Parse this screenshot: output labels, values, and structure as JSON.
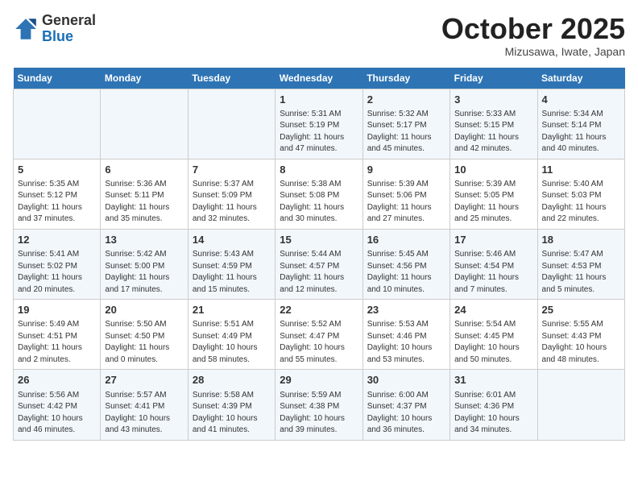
{
  "header": {
    "logo_line1": "General",
    "logo_line2": "Blue",
    "month": "October 2025",
    "location": "Mizusawa, Iwate, Japan"
  },
  "weekdays": [
    "Sunday",
    "Monday",
    "Tuesday",
    "Wednesday",
    "Thursday",
    "Friday",
    "Saturday"
  ],
  "weeks": [
    [
      {
        "day": "",
        "content": ""
      },
      {
        "day": "",
        "content": ""
      },
      {
        "day": "",
        "content": ""
      },
      {
        "day": "1",
        "content": "Sunrise: 5:31 AM\nSunset: 5:19 PM\nDaylight: 11 hours\nand 47 minutes."
      },
      {
        "day": "2",
        "content": "Sunrise: 5:32 AM\nSunset: 5:17 PM\nDaylight: 11 hours\nand 45 minutes."
      },
      {
        "day": "3",
        "content": "Sunrise: 5:33 AM\nSunset: 5:15 PM\nDaylight: 11 hours\nand 42 minutes."
      },
      {
        "day": "4",
        "content": "Sunrise: 5:34 AM\nSunset: 5:14 PM\nDaylight: 11 hours\nand 40 minutes."
      }
    ],
    [
      {
        "day": "5",
        "content": "Sunrise: 5:35 AM\nSunset: 5:12 PM\nDaylight: 11 hours\nand 37 minutes."
      },
      {
        "day": "6",
        "content": "Sunrise: 5:36 AM\nSunset: 5:11 PM\nDaylight: 11 hours\nand 35 minutes."
      },
      {
        "day": "7",
        "content": "Sunrise: 5:37 AM\nSunset: 5:09 PM\nDaylight: 11 hours\nand 32 minutes."
      },
      {
        "day": "8",
        "content": "Sunrise: 5:38 AM\nSunset: 5:08 PM\nDaylight: 11 hours\nand 30 minutes."
      },
      {
        "day": "9",
        "content": "Sunrise: 5:39 AM\nSunset: 5:06 PM\nDaylight: 11 hours\nand 27 minutes."
      },
      {
        "day": "10",
        "content": "Sunrise: 5:39 AM\nSunset: 5:05 PM\nDaylight: 11 hours\nand 25 minutes."
      },
      {
        "day": "11",
        "content": "Sunrise: 5:40 AM\nSunset: 5:03 PM\nDaylight: 11 hours\nand 22 minutes."
      }
    ],
    [
      {
        "day": "12",
        "content": "Sunrise: 5:41 AM\nSunset: 5:02 PM\nDaylight: 11 hours\nand 20 minutes."
      },
      {
        "day": "13",
        "content": "Sunrise: 5:42 AM\nSunset: 5:00 PM\nDaylight: 11 hours\nand 17 minutes."
      },
      {
        "day": "14",
        "content": "Sunrise: 5:43 AM\nSunset: 4:59 PM\nDaylight: 11 hours\nand 15 minutes."
      },
      {
        "day": "15",
        "content": "Sunrise: 5:44 AM\nSunset: 4:57 PM\nDaylight: 11 hours\nand 12 minutes."
      },
      {
        "day": "16",
        "content": "Sunrise: 5:45 AM\nSunset: 4:56 PM\nDaylight: 11 hours\nand 10 minutes."
      },
      {
        "day": "17",
        "content": "Sunrise: 5:46 AM\nSunset: 4:54 PM\nDaylight: 11 hours\nand 7 minutes."
      },
      {
        "day": "18",
        "content": "Sunrise: 5:47 AM\nSunset: 4:53 PM\nDaylight: 11 hours\nand 5 minutes."
      }
    ],
    [
      {
        "day": "19",
        "content": "Sunrise: 5:49 AM\nSunset: 4:51 PM\nDaylight: 11 hours\nand 2 minutes."
      },
      {
        "day": "20",
        "content": "Sunrise: 5:50 AM\nSunset: 4:50 PM\nDaylight: 11 hours\nand 0 minutes."
      },
      {
        "day": "21",
        "content": "Sunrise: 5:51 AM\nSunset: 4:49 PM\nDaylight: 10 hours\nand 58 minutes."
      },
      {
        "day": "22",
        "content": "Sunrise: 5:52 AM\nSunset: 4:47 PM\nDaylight: 10 hours\nand 55 minutes."
      },
      {
        "day": "23",
        "content": "Sunrise: 5:53 AM\nSunset: 4:46 PM\nDaylight: 10 hours\nand 53 minutes."
      },
      {
        "day": "24",
        "content": "Sunrise: 5:54 AM\nSunset: 4:45 PM\nDaylight: 10 hours\nand 50 minutes."
      },
      {
        "day": "25",
        "content": "Sunrise: 5:55 AM\nSunset: 4:43 PM\nDaylight: 10 hours\nand 48 minutes."
      }
    ],
    [
      {
        "day": "26",
        "content": "Sunrise: 5:56 AM\nSunset: 4:42 PM\nDaylight: 10 hours\nand 46 minutes."
      },
      {
        "day": "27",
        "content": "Sunrise: 5:57 AM\nSunset: 4:41 PM\nDaylight: 10 hours\nand 43 minutes."
      },
      {
        "day": "28",
        "content": "Sunrise: 5:58 AM\nSunset: 4:39 PM\nDaylight: 10 hours\nand 41 minutes."
      },
      {
        "day": "29",
        "content": "Sunrise: 5:59 AM\nSunset: 4:38 PM\nDaylight: 10 hours\nand 39 minutes."
      },
      {
        "day": "30",
        "content": "Sunrise: 6:00 AM\nSunset: 4:37 PM\nDaylight: 10 hours\nand 36 minutes."
      },
      {
        "day": "31",
        "content": "Sunrise: 6:01 AM\nSunset: 4:36 PM\nDaylight: 10 hours\nand 34 minutes."
      },
      {
        "day": "",
        "content": ""
      }
    ]
  ]
}
